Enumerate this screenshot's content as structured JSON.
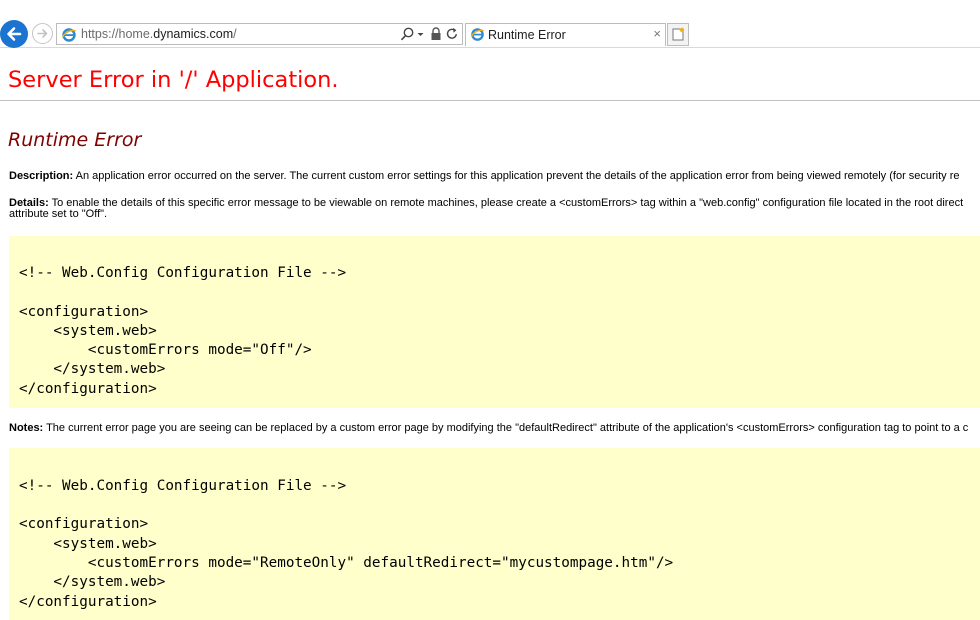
{
  "browser": {
    "url_prefix": "https://home.",
    "url_domain": "dynamics.com",
    "url_suffix": "/",
    "tab_title": "Runtime Error",
    "tab_close_glyph": "×"
  },
  "page": {
    "heading": "Server Error in '/' Application.",
    "subheading": "Runtime Error",
    "description_label": "Description:",
    "description_text": " An application error occurred on the server. The current custom error settings for this application prevent the details of the application error from being viewed remotely (for security re",
    "details_label": "Details:",
    "details_text_line1": " To enable the details of this specific error message to be viewable on remote machines, please create a <customErrors> tag within a \"web.config\" configuration file located in the root direct",
    "details_text_line2": "attribute set to \"Off\".",
    "code_block_1": [
      "<!-- Web.Config Configuration File -->",
      "",
      "<configuration>",
      "    <system.web>",
      "        <customErrors mode=\"Off\"/>",
      "    </system.web>",
      "</configuration>"
    ],
    "notes_label": "Notes:",
    "notes_text": " The current error page you are seeing can be replaced by a custom error page by modifying the \"defaultRedirect\" attribute of the application's <customErrors> configuration tag to point to a c",
    "code_block_2": [
      "<!-- Web.Config Configuration File -->",
      "",
      "<configuration>",
      "    <system.web>",
      "        <customErrors mode=\"RemoteOnly\" defaultRedirect=\"mycustompage.htm\"/>",
      "    </system.web>",
      "</configuration>"
    ]
  },
  "colors": {
    "heading": "#ff0000",
    "subheading": "#800000",
    "code_background": "#ffffcc",
    "back_button": "#1b75d0"
  },
  "icons": [
    "back-arrow-icon",
    "forward-arrow-icon",
    "ie-logo-icon",
    "search-icon",
    "dropdown-icon",
    "lock-icon",
    "refresh-icon",
    "close-icon",
    "new-tab-icon"
  ]
}
